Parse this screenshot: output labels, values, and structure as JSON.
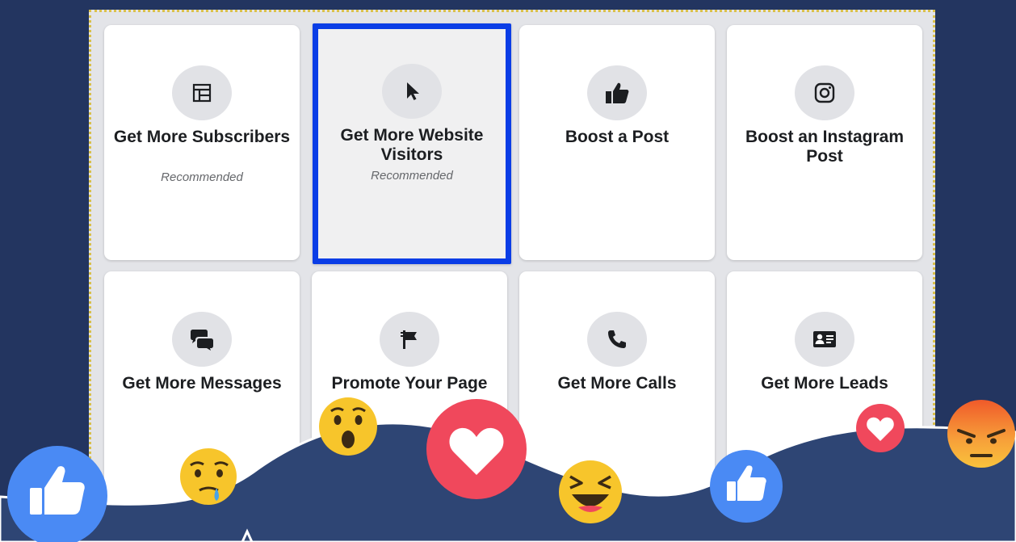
{
  "cards": [
    {
      "title": "Get More Subscribers",
      "sub": "Recommended",
      "icon": "subscribers-icon"
    },
    {
      "title": "Get More Website Visitors",
      "sub": "Recommended",
      "icon": "cursor-icon"
    },
    {
      "title": "Boost a Post",
      "sub": "",
      "icon": "thumbs-up-icon"
    },
    {
      "title": "Boost an Instagram Post",
      "sub": "",
      "icon": "instagram-icon"
    },
    {
      "title": "Get More Messages",
      "sub": "",
      "icon": "chat-bubbles-icon"
    },
    {
      "title": "Promote Your Page",
      "sub": "",
      "icon": "flag-icon"
    },
    {
      "title": "Get More Calls",
      "sub": "",
      "icon": "phone-icon"
    },
    {
      "title": "Get More Leads",
      "sub": "",
      "icon": "contact-card-icon"
    }
  ],
  "selected_card": "Get More Website Visitors",
  "colors": {
    "background": "#233560",
    "wave": "#2e4574",
    "selection": "#0a3de6",
    "like": "#4a8af4",
    "love": "#f0485c",
    "emoji_yellow": "#f7c52b",
    "angry_top": "#f05a2a"
  },
  "reactions": [
    "like-reaction-icon",
    "sad-reaction-icon",
    "wow-reaction-icon",
    "love-reaction-icon",
    "haha-reaction-icon",
    "like-reaction-icon",
    "love-reaction-icon",
    "angry-reaction-icon"
  ]
}
